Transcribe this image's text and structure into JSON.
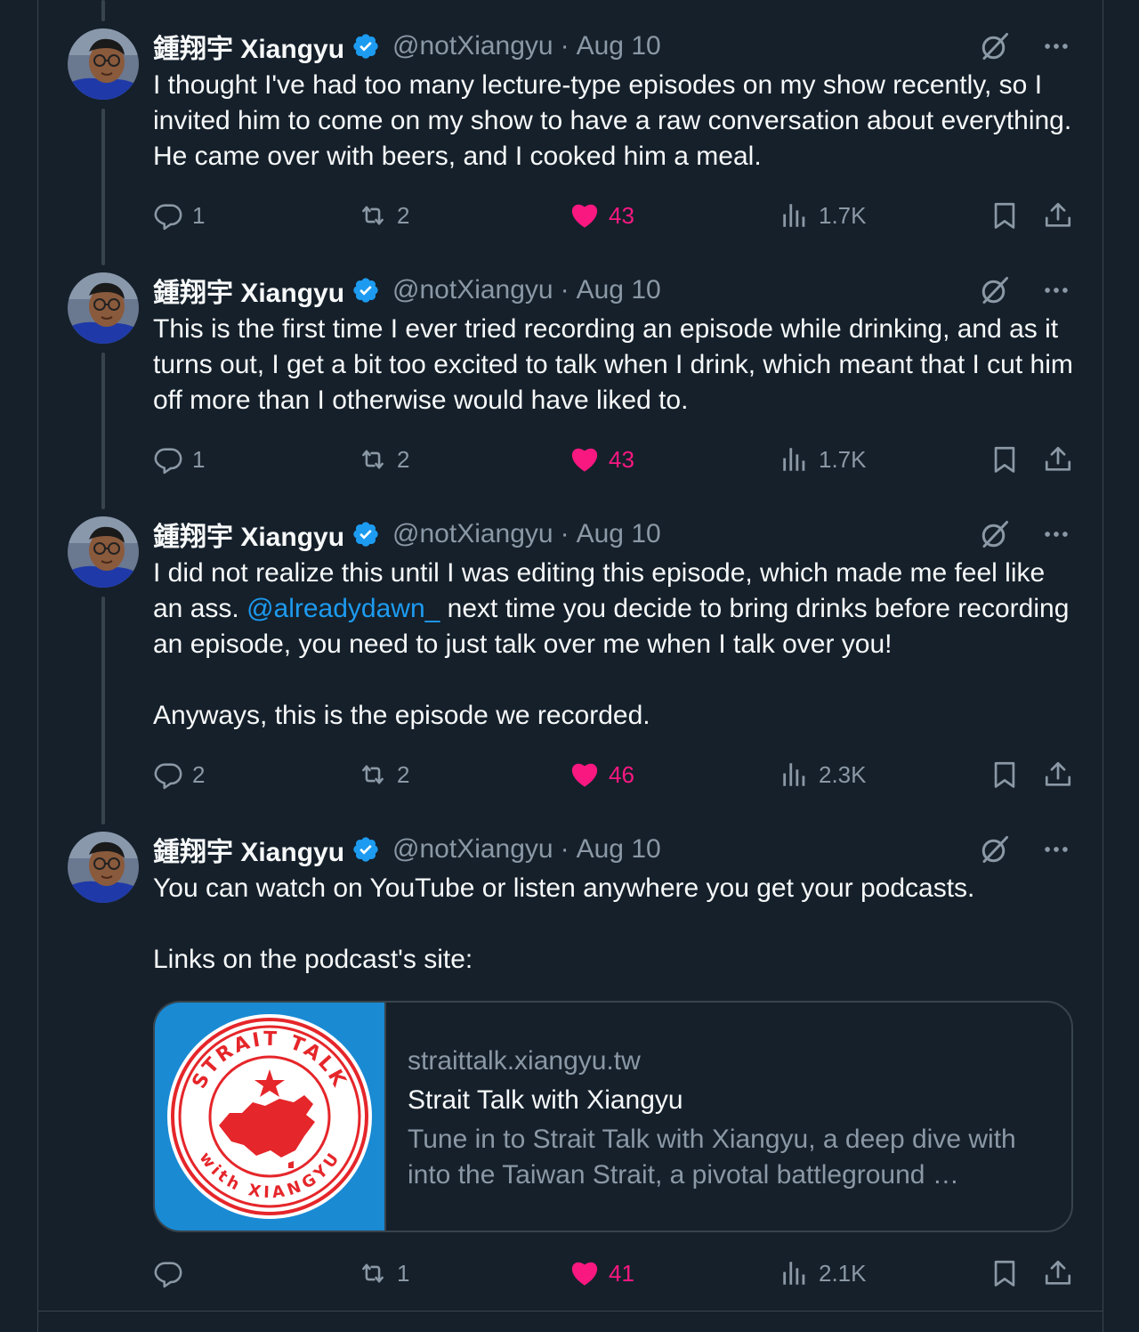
{
  "colors": {
    "background": "#15202b",
    "text": "#f7f9f9",
    "secondary": "#8b98a5",
    "accent": "#1d9bf0",
    "like": "#f91880",
    "border": "#38444d"
  },
  "author": {
    "display_name": "鍾翔宇 Xiangyu",
    "handle": "@notXiangyu",
    "separator": "·",
    "verified_icon": "verified-badge-icon"
  },
  "tweets": [
    {
      "date": "Aug 10",
      "text": "I thought I've had too many lecture-type episodes on my show recently, so I invited him to come on my show to have a raw conversation about everything. He came over with beers, and I cooked him a meal.",
      "replies": "1",
      "retweets": "2",
      "likes": "43",
      "views": "1.7K"
    },
    {
      "date": "Aug 10",
      "text": "This is the first time I ever tried recording an episode while drinking, and as it turns out, I get a bit too excited to talk when I drink, which meant that I cut him off more than I otherwise would have liked to.",
      "replies": "1",
      "retweets": "2",
      "likes": "43",
      "views": "1.7K"
    },
    {
      "date": "Aug 10",
      "text_before_mention": "I did not realize this until I was editing this episode, which made me feel like an ass. ",
      "mention": "@alreadydawn_",
      "text_after_mention": " next time you decide to bring drinks before recording an episode, you need to just talk over me when I talk over you!\n\nAnyways, this is the episode we recorded.",
      "replies": "2",
      "retweets": "2",
      "likes": "46",
      "views": "2.3K"
    },
    {
      "date": "Aug 10",
      "text": "You can watch on YouTube or listen anywhere you get your podcasts.\n\nLinks on the podcast's site:",
      "replies": "",
      "retweets": "1",
      "likes": "41",
      "views": "2.1K",
      "card": {
        "domain": "straittalk.xiangyu.tw",
        "title": "Strait Talk with Xiangyu",
        "description": "Tune in to Strait Talk with Xiangyu, a deep dive with into the Taiwan Strait, a pivotal battleground …",
        "logo_top_text": "STRAIT TALK",
        "logo_bottom_text": "with XIANGYU"
      }
    }
  ]
}
